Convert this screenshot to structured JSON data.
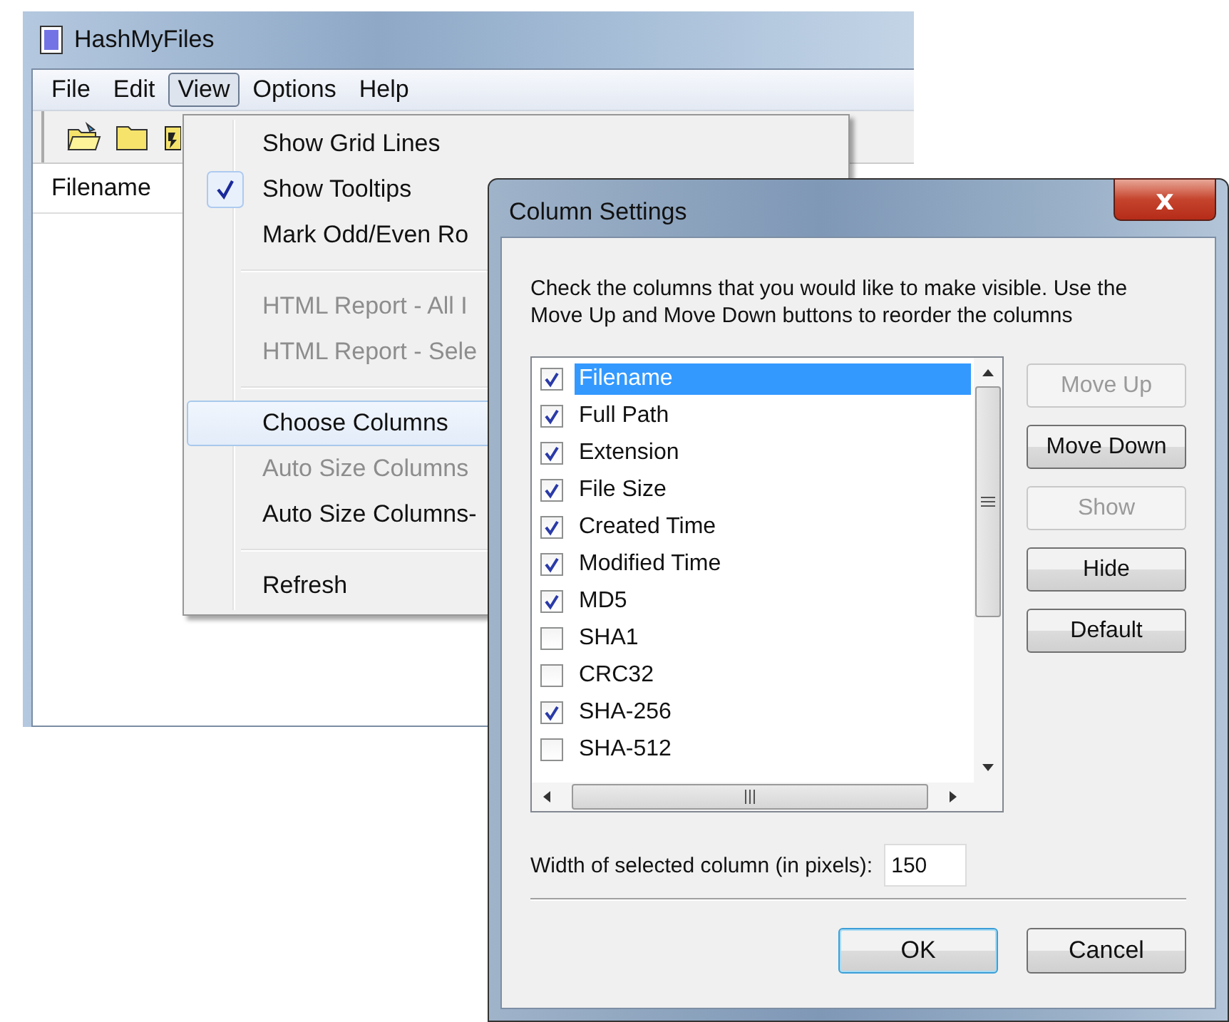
{
  "window": {
    "title": "HashMyFiles"
  },
  "menu_bar": [
    {
      "label": "File",
      "selected": false
    },
    {
      "label": "Edit",
      "selected": false
    },
    {
      "label": "View",
      "selected": true
    },
    {
      "label": "Options",
      "selected": false
    },
    {
      "label": "Help",
      "selected": false
    }
  ],
  "list_header": {
    "columns": [
      "Filename"
    ]
  },
  "view_menu": [
    {
      "kind": "item",
      "label": "Show Grid Lines",
      "checked": false,
      "disabled": false,
      "selected": false
    },
    {
      "kind": "item",
      "label": "Show Tooltips",
      "checked": true,
      "disabled": false,
      "selected": false
    },
    {
      "kind": "item",
      "label": "Mark Odd/Even Ro",
      "checked": false,
      "disabled": false,
      "selected": false
    },
    {
      "kind": "separator"
    },
    {
      "kind": "item",
      "label": "HTML Report - All I",
      "checked": false,
      "disabled": true,
      "selected": false
    },
    {
      "kind": "item",
      "label": "HTML Report - Sele",
      "checked": false,
      "disabled": true,
      "selected": false
    },
    {
      "kind": "separator"
    },
    {
      "kind": "item",
      "label": "Choose Columns",
      "checked": false,
      "disabled": false,
      "selected": true
    },
    {
      "kind": "item",
      "label": "Auto Size Columns",
      "checked": false,
      "disabled": true,
      "selected": false
    },
    {
      "kind": "item",
      "label": "Auto Size Columns-",
      "checked": false,
      "disabled": false,
      "selected": false
    },
    {
      "kind": "separator"
    },
    {
      "kind": "item",
      "label": "Refresh",
      "checked": false,
      "disabled": false,
      "selected": false
    }
  ],
  "dialog": {
    "title": "Column Settings",
    "close_symbol": "x",
    "instructions": "Check the columns that you would like to make visible. Use the Move Up and Move Down buttons to reorder the columns",
    "columns": [
      {
        "label": "Filename",
        "checked": true,
        "selected": true
      },
      {
        "label": "Full Path",
        "checked": true,
        "selected": false
      },
      {
        "label": "Extension",
        "checked": true,
        "selected": false
      },
      {
        "label": "File Size",
        "checked": true,
        "selected": false
      },
      {
        "label": "Created Time",
        "checked": true,
        "selected": false
      },
      {
        "label": "Modified Time",
        "checked": true,
        "selected": false
      },
      {
        "label": "MD5",
        "checked": true,
        "selected": false
      },
      {
        "label": "SHA1",
        "checked": false,
        "selected": false
      },
      {
        "label": "CRC32",
        "checked": false,
        "selected": false
      },
      {
        "label": "SHA-256",
        "checked": true,
        "selected": false
      },
      {
        "label": "SHA-512",
        "checked": false,
        "selected": false
      }
    ],
    "side_buttons": [
      {
        "label": "Move Up",
        "disabled": true
      },
      {
        "label": "Move Down",
        "disabled": false
      },
      {
        "label": "Show",
        "disabled": true
      },
      {
        "label": "Hide",
        "disabled": false
      },
      {
        "label": "Default",
        "disabled": false
      }
    ],
    "width_label": "Width of selected column (in pixels):",
    "width_value": "150",
    "footer_buttons": [
      {
        "label": "OK",
        "default": true
      },
      {
        "label": "Cancel",
        "default": false
      }
    ]
  }
}
